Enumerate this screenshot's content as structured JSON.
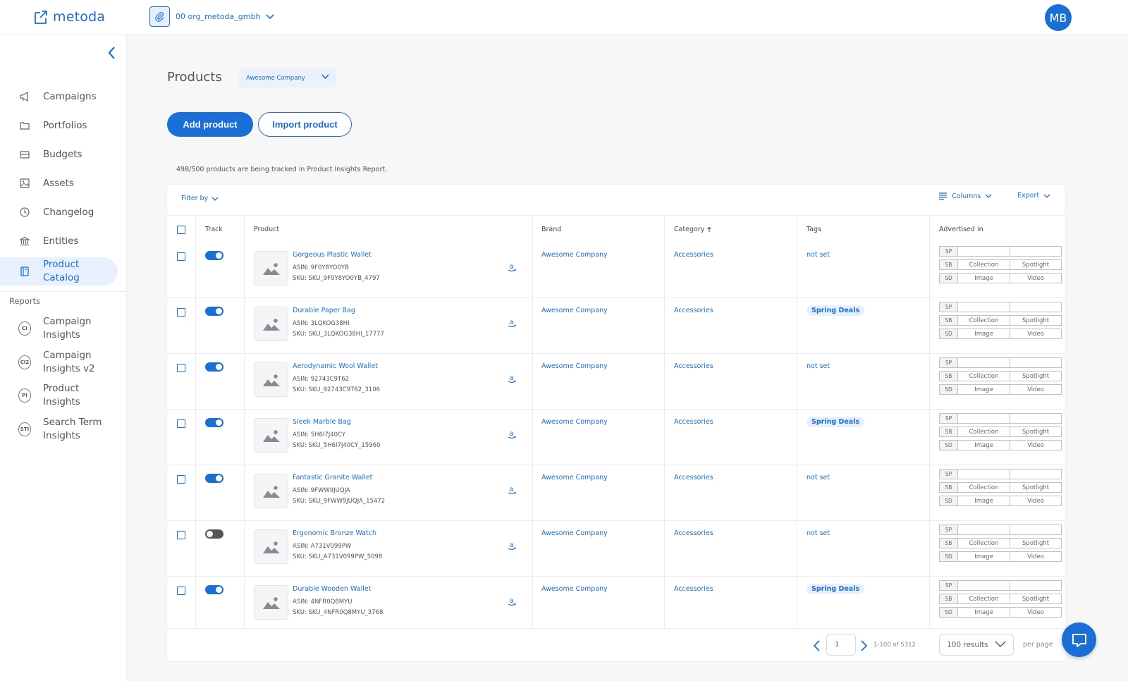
{
  "app": {
    "logo_text": "metoda"
  },
  "header": {
    "org_name": "00 org_metoda_gmbh",
    "avatar_initials": "MB"
  },
  "sidebar": {
    "items": [
      {
        "label": "Campaigns",
        "icon": "megaphone-icon"
      },
      {
        "label": "Portfolios",
        "icon": "folder-icon"
      },
      {
        "label": "Budgets",
        "icon": "wallet-icon"
      },
      {
        "label": "Assets",
        "icon": "image-icon"
      },
      {
        "label": "Changelog",
        "icon": "clock-icon"
      },
      {
        "label": "Entities",
        "icon": "bank-icon"
      },
      {
        "label": "Product\nCatalog",
        "icon": "book-icon",
        "active": true
      }
    ],
    "reports_heading": "Reports",
    "reports": [
      {
        "abbr": "CI",
        "label": "Campaign\nInsights"
      },
      {
        "abbr": "CI2",
        "label": "Campaign\nInsights v2"
      },
      {
        "abbr": "PI",
        "label": "Product\nInsights"
      },
      {
        "abbr": "STI",
        "label": "Search Term\nInsights"
      }
    ]
  },
  "main": {
    "title": "Products",
    "company_selector": "Awesome Company",
    "add_button": "Add product",
    "import_button": "Import product",
    "tracking_note": "498/500 products are being tracked in Product Insights Report."
  },
  "toolbar": {
    "filter_by": "Filter by",
    "columns": "Columns",
    "export": "Export"
  },
  "table": {
    "headers": {
      "track": "Track",
      "product": "Product",
      "brand": "Brand",
      "category": "Category",
      "tags": "Tags",
      "advertised_in": "Advertised in"
    },
    "adv_labels": {
      "sp": "SP",
      "sb": "SB",
      "sd": "SD",
      "collection": "Collection",
      "spotlight": "Spotlight",
      "image": "Image",
      "video": "Video"
    },
    "rows": [
      {
        "name": "Gorgeous Plastic Wallet",
        "asin": "ASIN: 9F0Y8YO0YB",
        "sku": "SKU: SKU_9F0Y8YO0YB_4797",
        "brand": "Awesome Company",
        "category": "Accessories",
        "tag": "not set",
        "tag_chip": false,
        "tracked": true
      },
      {
        "name": "Durable Paper Bag",
        "asin": "ASIN: 3LQKOG38HI",
        "sku": "SKU: SKU_3LQKOG38HI_17777",
        "brand": "Awesome Company",
        "category": "Accessories",
        "tag": "Spring Deals",
        "tag_chip": true,
        "tracked": true
      },
      {
        "name": "Aerodynamic Wool Wallet",
        "asin": "ASIN: 92743C9T62",
        "sku": "SKU: SKU_92743C9T62_3106",
        "brand": "Awesome Company",
        "category": "Accessories",
        "tag": "not set",
        "tag_chip": false,
        "tracked": true
      },
      {
        "name": "Sleek Marble Bag",
        "asin": "ASIN: 5H6I7J40CY",
        "sku": "SKU: SKU_5H6I7J40CY_15960",
        "brand": "Awesome Company",
        "category": "Accessories",
        "tag": "Spring Deals",
        "tag_chip": true,
        "tracked": true
      },
      {
        "name": "Fantastic Granite Wallet",
        "asin": "ASIN: 9FWW9JUQJA",
        "sku": "SKU: SKU_9FWW9JUQJA_15472",
        "brand": "Awesome Company",
        "category": "Accessories",
        "tag": "not set",
        "tag_chip": false,
        "tracked": true
      },
      {
        "name": "Ergonomic Bronze Watch",
        "asin": "ASIN: A731V099PW",
        "sku": "SKU: SKU_A731V099PW_5098",
        "brand": "Awesome Company",
        "category": "Accessories",
        "tag": "not set",
        "tag_chip": false,
        "tracked": false
      },
      {
        "name": "Durable Wooden Wallet",
        "asin": "ASIN: 4NFR0Q8MYU",
        "sku": "SKU: SKU_4NFR0Q8MYU_3768",
        "brand": "Awesome Company",
        "category": "Accessories",
        "tag": "Spring Deals",
        "tag_chip": true,
        "tracked": true
      }
    ]
  },
  "pagination": {
    "page": "1",
    "range": "1-100 of 5312",
    "per_page_value": "100 results",
    "per_page_label": "per page"
  },
  "colors": {
    "accent": "#1a6fd6",
    "accent_light": "#e8f0fd"
  }
}
